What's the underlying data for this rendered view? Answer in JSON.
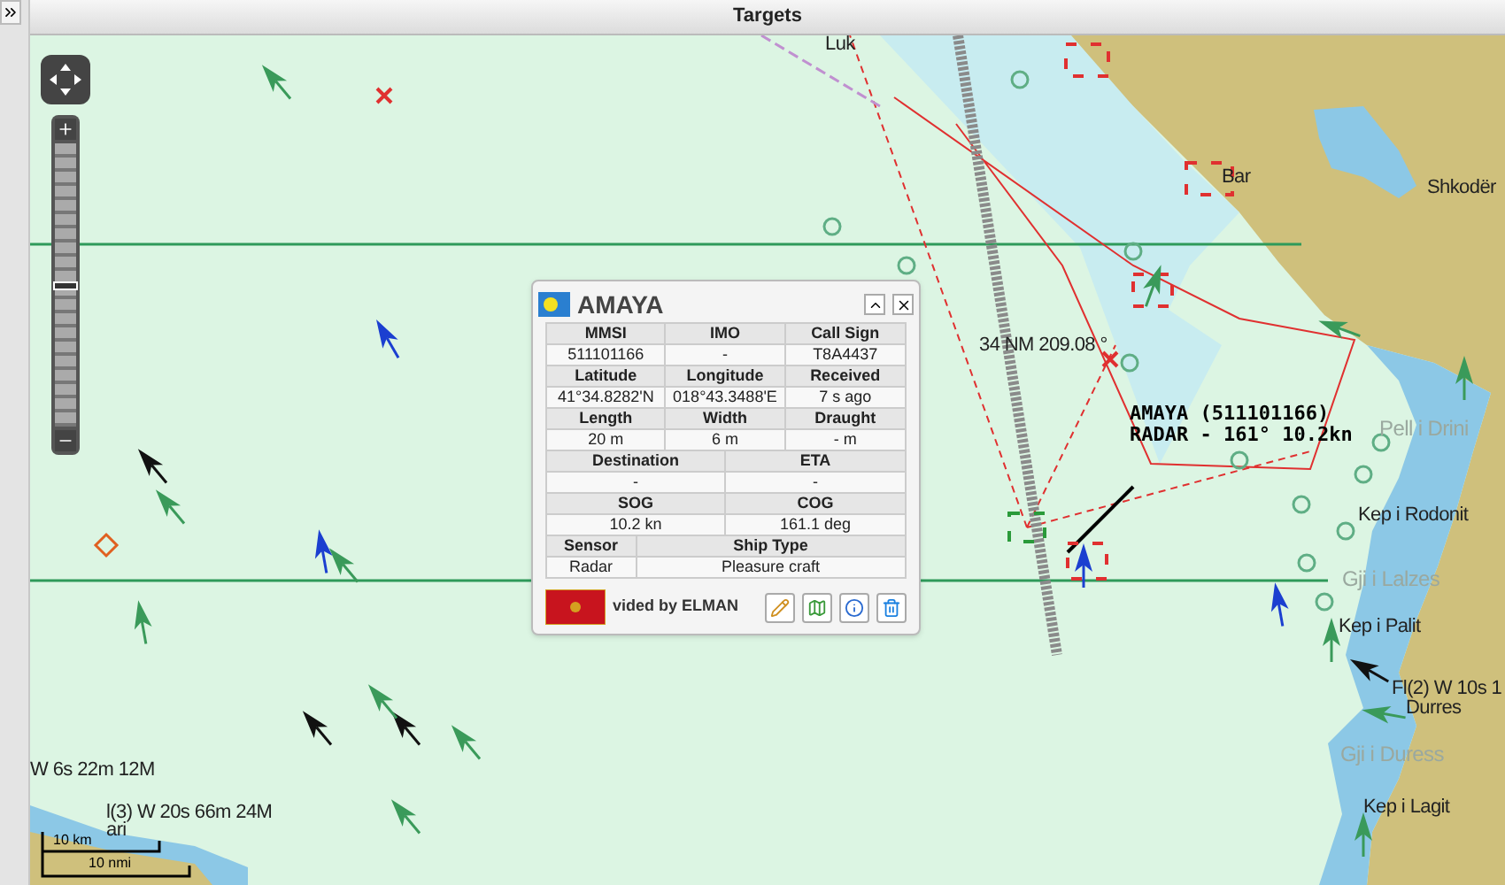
{
  "header": {
    "title": "Targets"
  },
  "zoom": {
    "level": 0.5
  },
  "map_labels": [
    {
      "kind": "place",
      "text": "Luk"
    },
    {
      "kind": "place",
      "text": "Bar"
    },
    {
      "kind": "place",
      "text": "Shkodër"
    },
    {
      "kind": "faded",
      "text": "Pell i Drini"
    },
    {
      "kind": "place",
      "text": "Kep i Rodonit"
    },
    {
      "kind": "faded",
      "text": "Gji i Lalzes"
    },
    {
      "kind": "place",
      "text": "Kep i Palit"
    },
    {
      "kind": "place",
      "text": "Fl(2) W 10s 1"
    },
    {
      "kind": "place",
      "text": "Durres"
    },
    {
      "kind": "faded",
      "text": "Gji i Duress"
    },
    {
      "kind": "place",
      "text": "Kep i Lagit"
    },
    {
      "kind": "place",
      "text": "W 6s 22m 12M"
    },
    {
      "kind": "place",
      "text": "l(3) W 20s 66m 24M"
    },
    {
      "kind": "place",
      "text": "ari"
    },
    {
      "kind": "place",
      "text": "34 NM 209.08 °"
    }
  ],
  "vessel_label": [
    "AMAYA (511101166)",
    "RADAR - 161° 10.2kn"
  ],
  "scale": [
    "10 km",
    "10 nmi"
  ],
  "popup": {
    "title": "AMAYA",
    "rows": [
      {
        "kind": "even",
        "cells": [
          {
            "label": "MMSI",
            "value": "511101166"
          },
          {
            "label": "IMO",
            "value": "-"
          },
          {
            "label": "Call Sign",
            "value": "T8A4437"
          }
        ]
      },
      {
        "kind": "even",
        "cells": [
          {
            "label": "Latitude",
            "value": "41°34.8282'N"
          },
          {
            "label": "Longitude",
            "value": "018°43.3488'E"
          },
          {
            "label": "Received",
            "value": "7 s ago"
          }
        ]
      },
      {
        "kind": "even",
        "cells": [
          {
            "label": "Length",
            "value": "20 m"
          },
          {
            "label": "Width",
            "value": "6 m"
          },
          {
            "label": "Draught",
            "value": "- m"
          }
        ]
      },
      {
        "kind": "even",
        "cells": [
          {
            "label": "Destination",
            "value": "-"
          },
          {
            "label": "ETA",
            "value": "-"
          }
        ]
      },
      {
        "kind": "even",
        "cells": [
          {
            "label": "SOG",
            "value": "10.2 kn"
          },
          {
            "label": "COG",
            "value": "161.1 deg"
          }
        ]
      },
      {
        "kind": "wide_right",
        "cells": [
          {
            "label": "Sensor",
            "value": "Radar"
          },
          {
            "label": "Ship Type",
            "value": "Pleasure craft"
          }
        ]
      }
    ],
    "footer": "vided by ELMAN"
  }
}
